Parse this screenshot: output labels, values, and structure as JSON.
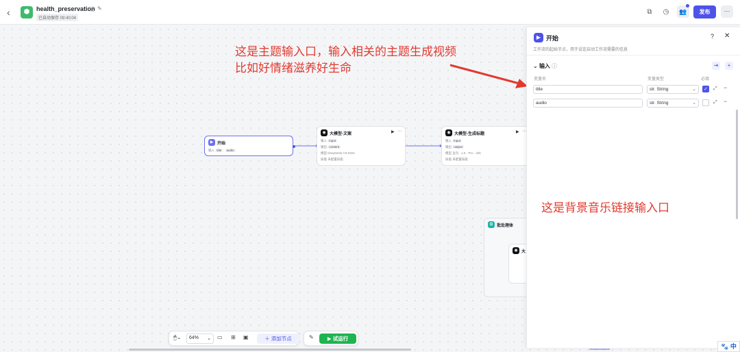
{
  "header": {
    "title": "health_preservation",
    "autosave": "已自动保存 09:40:04",
    "publish_label": "发布"
  },
  "nodes": {
    "start": {
      "title": "开始",
      "input_label": "输入",
      "params": [
        "title",
        "audio"
      ]
    },
    "llm_copy": {
      "title": "大模型-文案",
      "input_label": "输入",
      "input": "input",
      "output_label": "输出",
      "output": "content",
      "model_label": "模型",
      "model": "DeepSeek-V3-0324",
      "skill_label": "技能",
      "skill": "未配置技能"
    },
    "llm_title": {
      "title": "大模型-生成标题",
      "input_label": "输入",
      "input": "input",
      "output_label": "输出",
      "output": "output",
      "model_label": "模型",
      "model": "豆包 · 1.5 · Pro · 32k",
      "skill_label": "技能",
      "skill": "未配置技能"
    },
    "batch": {
      "title": "批处理体",
      "inner_title": "大"
    }
  },
  "panel": {
    "title": "开始",
    "description": "工作流的起始节点，用于设定启动工作流需要的信息",
    "section_title": "输入",
    "col_name": "变量名",
    "col_type": "变量类型",
    "col_required": "必填",
    "fields": [
      {
        "name": "title",
        "type": "str. String",
        "required": true
      },
      {
        "name": "audio",
        "type": "str. String",
        "required": false
      }
    ]
  },
  "annotations": {
    "line1": "这是主题输入口，输入相关的主题生成视频",
    "line2": "比如好情绪滋养好生命",
    "line3": "这是背景音乐链接输入口",
    "color": "#e23a2f"
  },
  "toolbar": {
    "zoom": "64%",
    "add_node": "添加节点",
    "run": "试运行"
  },
  "ime": {
    "label": "中"
  },
  "colors": {
    "accent": "#4d53e8",
    "run": "#1db451"
  }
}
